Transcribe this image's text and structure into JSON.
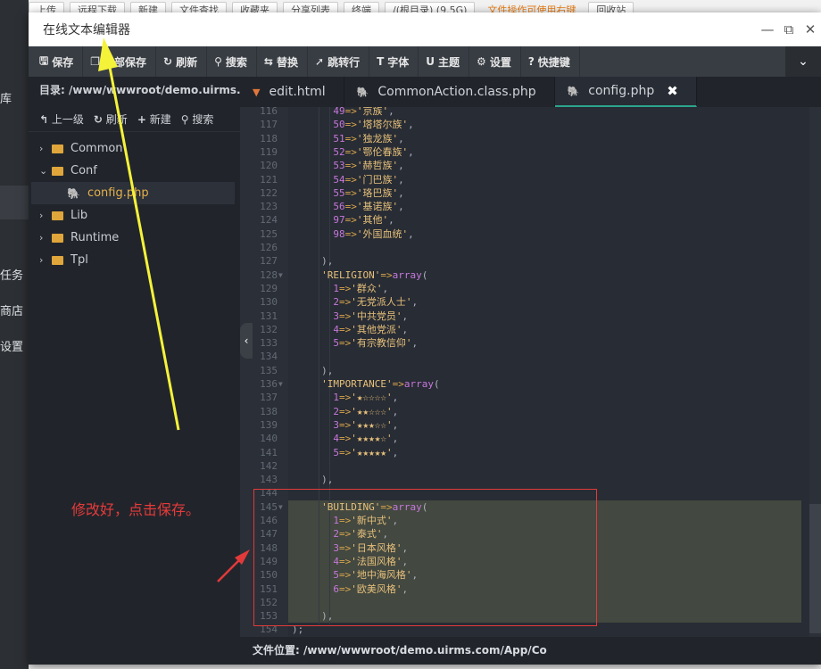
{
  "background": {
    "left_items": [
      "库",
      "任务",
      "商店",
      "设置"
    ],
    "top_tabs": [
      "上传",
      "远程下载",
      "新建",
      "文件查找",
      "收藏夹",
      "分享列表",
      "终端",
      "/(根目录) (9.5G)"
    ],
    "top_warn": "文件操作可使用右键",
    "top_right": "回收站"
  },
  "window": {
    "title": "在线文本编辑器",
    "controls": {
      "minimize": "—",
      "maximize": "⧉",
      "close": "✕"
    }
  },
  "toolbar": {
    "items": [
      {
        "icon": "save-icon",
        "glyph": "🖫",
        "label": "保存"
      },
      {
        "icon": "save-all-icon",
        "glyph": "❐",
        "label": "全部保存"
      },
      {
        "icon": "refresh-icon",
        "glyph": "↻",
        "label": "刷新"
      },
      {
        "icon": "search-icon",
        "glyph": "⚲",
        "label": "搜索"
      },
      {
        "icon": "replace-icon",
        "glyph": "⇆",
        "label": "替换"
      },
      {
        "icon": "goto-line-icon",
        "glyph": "➚",
        "label": "跳转行"
      },
      {
        "icon": "font-icon",
        "glyph": "T",
        "label": "字体"
      },
      {
        "icon": "theme-icon",
        "glyph": "U",
        "label": "主题"
      },
      {
        "icon": "gear-icon",
        "glyph": "⚙",
        "label": "设置"
      },
      {
        "icon": "help-icon",
        "glyph": "?",
        "label": "快捷键"
      }
    ],
    "chevron": "⌄"
  },
  "sidebar": {
    "dir_label": "目录: /www/wwwroot/demo.uirms.c...",
    "actions": [
      {
        "glyph": "↰",
        "label": "上一级"
      },
      {
        "glyph": "↻",
        "label": "刷新"
      },
      {
        "glyph": "+",
        "label": "新建"
      },
      {
        "glyph": "⚲",
        "label": "搜索"
      }
    ],
    "tree": [
      {
        "type": "folder",
        "label": "Common",
        "expanded": false
      },
      {
        "type": "folder",
        "label": "Conf",
        "expanded": true
      },
      {
        "type": "file",
        "label": "config.php"
      },
      {
        "type": "folder",
        "label": "Lib",
        "expanded": false
      },
      {
        "type": "folder",
        "label": "Runtime",
        "expanded": false
      },
      {
        "type": "folder",
        "label": "Tpl",
        "expanded": false
      }
    ],
    "collapse_glyph": "‹"
  },
  "tabs": [
    {
      "label": "edit.html",
      "kind": "html",
      "icon": "html5-icon",
      "glyph": "▼",
      "active": false
    },
    {
      "label": "CommonAction.class.php",
      "kind": "php",
      "icon": "php-elephant-icon",
      "glyph": "🐘",
      "active": false
    },
    {
      "label": "config.php",
      "kind": "php",
      "icon": "php-elephant-icon",
      "glyph": "🐘",
      "active": true,
      "close": "✖"
    }
  ],
  "code_lines": [
    {
      "no": 116,
      "indent": 7,
      "key": "49",
      "val": "'京族'"
    },
    {
      "no": 117,
      "indent": 7,
      "key": "50",
      "val": "'塔塔尔族'"
    },
    {
      "no": 118,
      "indent": 7,
      "key": "51",
      "val": "'独龙族'"
    },
    {
      "no": 119,
      "indent": 7,
      "key": "52",
      "val": "'鄂伦春族'"
    },
    {
      "no": 120,
      "indent": 7,
      "key": "53",
      "val": "'赫哲族'"
    },
    {
      "no": 121,
      "indent": 7,
      "key": "54",
      "val": "'门巴族'"
    },
    {
      "no": 122,
      "indent": 7,
      "key": "55",
      "val": "'珞巴族'"
    },
    {
      "no": 123,
      "indent": 7,
      "key": "56",
      "val": "'基诺族'"
    },
    {
      "no": 124,
      "indent": 7,
      "key": "97",
      "val": "'其他'"
    },
    {
      "no": 125,
      "indent": 7,
      "key": "98",
      "val": "'外国血统'"
    },
    {
      "no": 126,
      "indent": 0,
      "raw": ""
    },
    {
      "no": 127,
      "indent": 5,
      "raw": "),"
    },
    {
      "no": 128,
      "indent": 5,
      "fold": true,
      "akey": "'RELIGION'"
    },
    {
      "no": 129,
      "indent": 7,
      "key": "1",
      "val": "'群众'"
    },
    {
      "no": 130,
      "indent": 7,
      "key": "2",
      "val": "'无党派人士'"
    },
    {
      "no": 131,
      "indent": 7,
      "key": "3",
      "val": "'中共党员'"
    },
    {
      "no": 132,
      "indent": 7,
      "key": "4",
      "val": "'其他党派'"
    },
    {
      "no": 133,
      "indent": 7,
      "key": "5",
      "val": "'有宗教信仰'"
    },
    {
      "no": 134,
      "indent": 0,
      "raw": ""
    },
    {
      "no": 135,
      "indent": 5,
      "raw": "),"
    },
    {
      "no": 136,
      "indent": 5,
      "fold": true,
      "akey": "'IMPORTANCE'"
    },
    {
      "no": 137,
      "indent": 7,
      "key": "1",
      "val": "'★☆☆☆☆'"
    },
    {
      "no": 138,
      "indent": 7,
      "key": "2",
      "val": "'★★☆☆☆'"
    },
    {
      "no": 139,
      "indent": 7,
      "key": "3",
      "val": "'★★★☆☆'"
    },
    {
      "no": 140,
      "indent": 7,
      "key": "4",
      "val": "'★★★★☆'"
    },
    {
      "no": 141,
      "indent": 7,
      "key": "5",
      "val": "'★★★★★'"
    },
    {
      "no": 142,
      "indent": 0,
      "raw": ""
    },
    {
      "no": 143,
      "indent": 5,
      "raw": "),"
    },
    {
      "no": 144,
      "indent": 0,
      "raw": ""
    },
    {
      "no": 145,
      "indent": 5,
      "fold": true,
      "akey": "'BUILDING'",
      "hl": true
    },
    {
      "no": 146,
      "indent": 7,
      "key": "1",
      "val": "'新中式'",
      "hl": true
    },
    {
      "no": 147,
      "indent": 7,
      "key": "2",
      "val": "'泰式'",
      "hl": true
    },
    {
      "no": 148,
      "indent": 7,
      "key": "3",
      "val": "'日本风格'",
      "hl": true
    },
    {
      "no": 149,
      "indent": 7,
      "key": "4",
      "val": "'法国风格'",
      "hl": true
    },
    {
      "no": 150,
      "indent": 7,
      "key": "5",
      "val": "'地中海风格'",
      "hl": true
    },
    {
      "no": 151,
      "indent": 7,
      "key": "6",
      "val": "'欧美风格'",
      "hl": true
    },
    {
      "no": 152,
      "indent": 0,
      "raw": "",
      "hl": true
    },
    {
      "no": 153,
      "indent": 5,
      "raw": "),",
      "hl": true
    },
    {
      "no": 154,
      "indent": 0,
      "raw": ");"
    }
  ],
  "syntax": {
    "arrow": "=>",
    "array_kw": "array",
    "open": "(",
    "comma": ","
  },
  "status": {
    "file_location": "文件位置: /www/wwwroot/demo.uirms.com/App/Co"
  },
  "annotation": {
    "text": "修改好，点击保存。",
    "red": "#e83a3a",
    "yellow": "#f5f23a"
  }
}
